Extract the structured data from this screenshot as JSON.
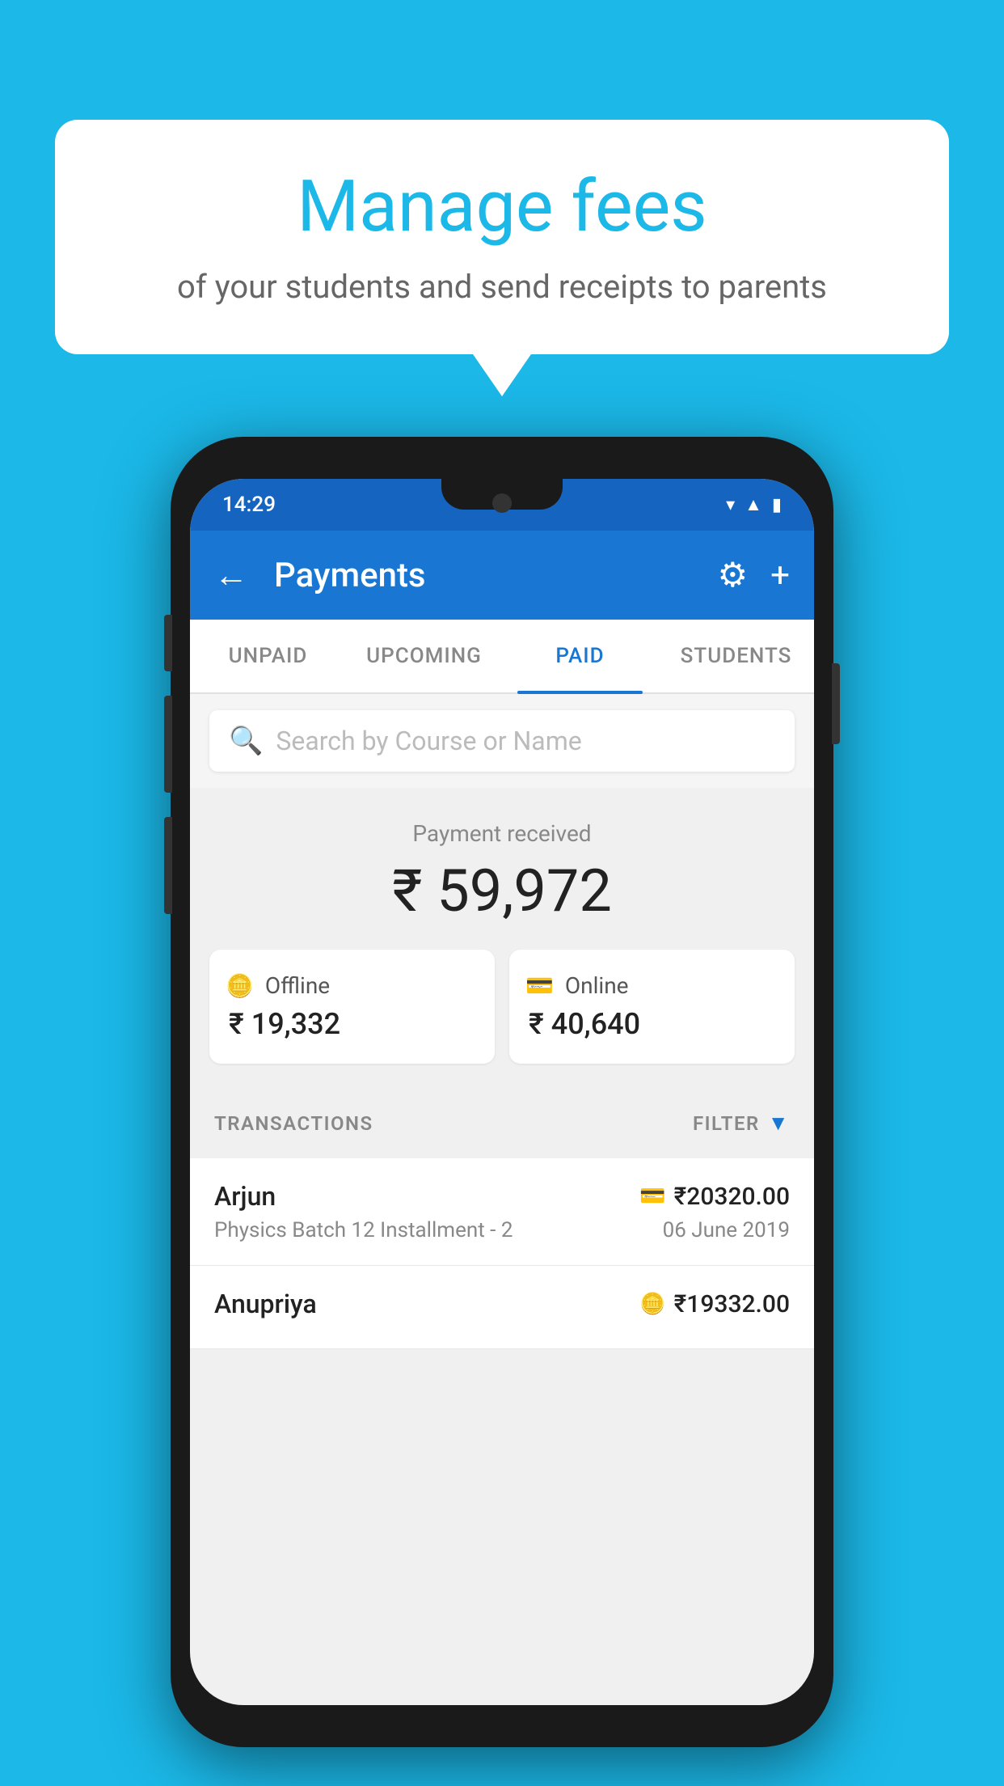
{
  "background_color": "#1BB8E8",
  "speech_bubble": {
    "title": "Manage fees",
    "subtitle": "of your students and send receipts to parents"
  },
  "status_bar": {
    "time": "14:29",
    "icons": [
      "wifi",
      "signal",
      "battery"
    ]
  },
  "app_bar": {
    "title": "Payments",
    "back_label": "←",
    "gear_label": "⚙",
    "plus_label": "+"
  },
  "tabs": [
    {
      "label": "UNPAID",
      "active": false
    },
    {
      "label": "UPCOMING",
      "active": false
    },
    {
      "label": "PAID",
      "active": true
    },
    {
      "label": "STUDENTS",
      "active": false
    }
  ],
  "search": {
    "placeholder": "Search by Course or Name"
  },
  "payment_summary": {
    "label": "Payment received",
    "amount": "₹ 59,972",
    "offline": {
      "type": "Offline",
      "amount": "₹ 19,332",
      "icon": "💳"
    },
    "online": {
      "type": "Online",
      "amount": "₹ 40,640",
      "icon": "💳"
    }
  },
  "transactions_header": {
    "label": "TRANSACTIONS",
    "filter_label": "FILTER"
  },
  "transactions": [
    {
      "name": "Arjun",
      "course": "Physics Batch 12 Installment - 2",
      "amount": "₹20320.00",
      "date": "06 June 2019",
      "type_icon": "online"
    },
    {
      "name": "Anupriya",
      "course": "",
      "amount": "₹19332.00",
      "date": "",
      "type_icon": "offline"
    }
  ]
}
